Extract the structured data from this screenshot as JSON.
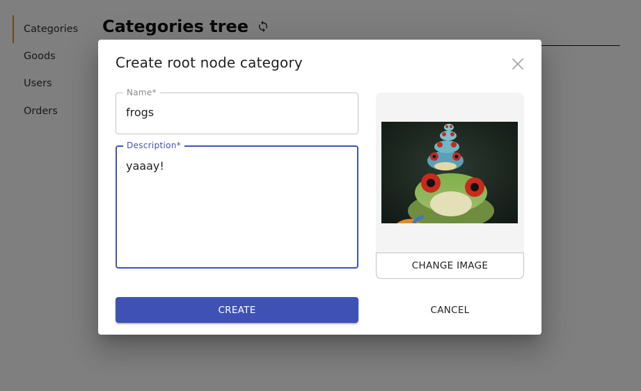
{
  "sidebar": {
    "items": [
      {
        "label": "Categories",
        "active": true
      },
      {
        "label": "Goods",
        "active": false
      },
      {
        "label": "Users",
        "active": false
      },
      {
        "label": "Orders",
        "active": false
      }
    ]
  },
  "page": {
    "title": "Categories tree",
    "refresh_icon": "refresh-icon"
  },
  "dialog": {
    "title": "Create root node category",
    "close_icon": "close-icon",
    "name_field": {
      "label": "Name*",
      "value": "frogs"
    },
    "description_field": {
      "label": "Description*",
      "value": "yaaay!"
    },
    "image": {
      "change_label": "CHANGE IMAGE"
    },
    "create_label": "CREATE",
    "cancel_label": "CANCEL"
  },
  "colors": {
    "accent": "#3f51b5",
    "active_marker": "#c8952a",
    "backdrop": "rgba(0,0,0,0.5)"
  }
}
